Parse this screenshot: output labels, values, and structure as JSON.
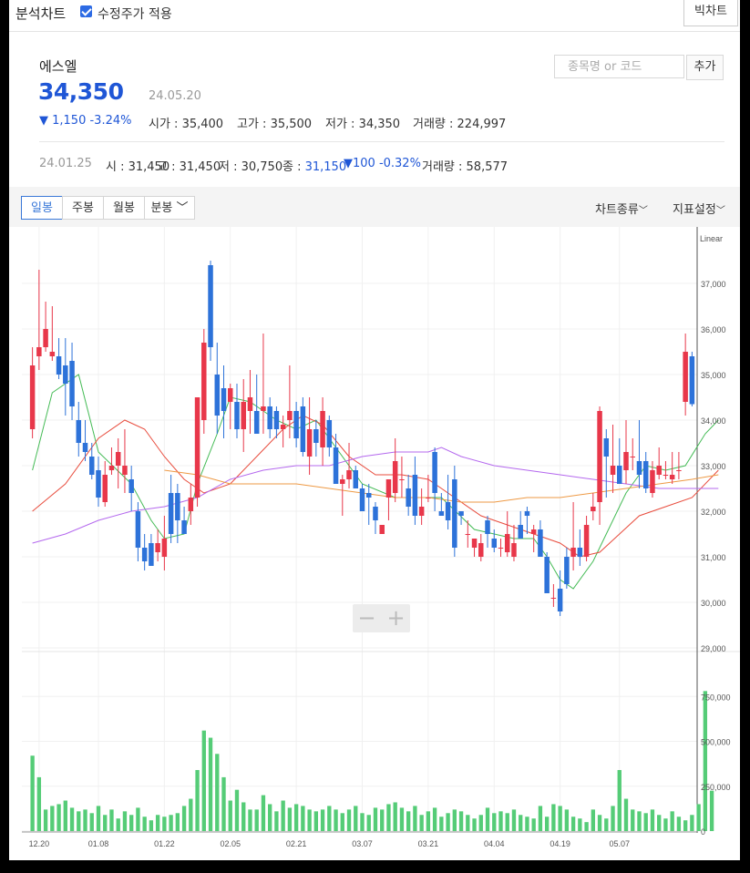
{
  "topbar": {
    "title": "분석차트",
    "adjusted_label": "수정주가 적용",
    "adjusted_checked": true,
    "big_chart_label": "빅차트"
  },
  "stock": {
    "name": "에스엘",
    "price": "34,350",
    "date": "24.05.20",
    "change": "▼ 1,150 -3.24%",
    "open": "시가 : 35,400",
    "high": "고가 : 35,500",
    "low": "저가 : 34,350",
    "volume": "거래량 : 224,997"
  },
  "search": {
    "placeholder": "종목명 or 코드",
    "add_label": "추가"
  },
  "history": {
    "date": "24.01.25",
    "open": "시 : 31,450",
    "high": "고 : 31,450",
    "low": "저 : 30,750",
    "close_label": "종 : ",
    "close": "31,150",
    "change": "▼100 -0.32%",
    "volume": "거래량 : 58,577"
  },
  "tabs": [
    "일봉",
    "주봉",
    "월봉",
    "분봉"
  ],
  "active_tab": "일봉",
  "menus": {
    "chart_type": "차트종류",
    "indicator": "지표설정"
  },
  "colors": {
    "up": "#e8374a",
    "down": "#2d72d9",
    "volume": "#55cc77",
    "ma5": "#44bb55",
    "ma20": "#e84c3d",
    "ma60": "#b468ee",
    "ma120": "#ee9944"
  },
  "chart_data": {
    "type": "candlestick",
    "scale_label": "Linear",
    "price_ticks": [
      "37,000",
      "36,000",
      "35,000",
      "34,000",
      "33,000",
      "32,000",
      "31,000",
      "30,000",
      "29,000"
    ],
    "volume_ticks": [
      "750,000",
      "500,000",
      "250,000",
      "0"
    ],
    "x_labels": [
      "12.20",
      "01.08",
      "01.22",
      "02.05",
      "02.21",
      "03.07",
      "03.21",
      "04.04",
      "04.19",
      "05.07"
    ],
    "x_label_index": [
      1,
      10,
      20,
      30,
      40,
      50,
      60,
      70,
      80,
      89
    ],
    "ylim": [
      29000,
      38000
    ],
    "candles": [
      [
        33800,
        35600,
        33600,
        35200
      ],
      [
        35400,
        37300,
        35100,
        35600
      ],
      [
        35600,
        36600,
        35500,
        36000
      ],
      [
        35400,
        36500,
        35300,
        35500
      ],
      [
        35400,
        35800,
        34900,
        35000
      ],
      [
        35200,
        35800,
        34100,
        34800
      ],
      [
        35300,
        35700,
        34000,
        34300
      ],
      [
        34000,
        34400,
        33200,
        33500
      ],
      [
        33500,
        34000,
        33100,
        33300
      ],
      [
        33200,
        33500,
        32700,
        32800
      ],
      [
        32900,
        33200,
        32100,
        32300
      ],
      [
        32200,
        33100,
        32100,
        32800
      ],
      [
        32900,
        33400,
        32800,
        33000
      ],
      [
        33000,
        33600,
        32500,
        33300
      ],
      [
        32800,
        33800,
        32400,
        33000
      ],
      [
        32700,
        33000,
        32000,
        32400
      ],
      [
        32000,
        32200,
        30900,
        31200
      ],
      [
        31200,
        31500,
        30700,
        30900
      ],
      [
        31300,
        31500,
        30800,
        30800
      ],
      [
        31100,
        31600,
        30900,
        31300
      ],
      [
        31000,
        31900,
        30700,
        31400
      ],
      [
        32400,
        32800,
        31300,
        31500
      ],
      [
        32400,
        32600,
        31300,
        31800
      ],
      [
        31800,
        32100,
        31500,
        31500
      ],
      [
        32000,
        32600,
        31700,
        32300
      ],
      [
        32300,
        34400,
        32100,
        34500
      ],
      [
        34000,
        36000,
        33700,
        35700
      ],
      [
        37400,
        37500,
        35300,
        35600
      ],
      [
        35000,
        35700,
        33700,
        34100
      ],
      [
        34700,
        35200,
        33600,
        34200
      ],
      [
        34400,
        34800,
        33800,
        34700
      ],
      [
        34400,
        34800,
        33600,
        33800
      ],
      [
        33800,
        34900,
        33300,
        34400
      ],
      [
        34200,
        35100,
        33700,
        34500
      ],
      [
        34200,
        35000,
        33700,
        33700
      ],
      [
        34200,
        35900,
        33700,
        34300
      ],
      [
        34300,
        34500,
        33600,
        33800
      ],
      [
        34200,
        34300,
        33600,
        33800
      ],
      [
        33800,
        34100,
        33400,
        33900
      ],
      [
        34000,
        35200,
        33600,
        34200
      ],
      [
        34200,
        34400,
        33400,
        33600
      ],
      [
        34300,
        34500,
        33200,
        33300
      ],
      [
        33200,
        34500,
        32800,
        33800
      ],
      [
        33800,
        34000,
        33200,
        33500
      ],
      [
        33400,
        34500,
        33000,
        34200
      ],
      [
        34000,
        34100,
        33200,
        33400
      ],
      [
        33400,
        33700,
        32600,
        32600
      ],
      [
        32600,
        32800,
        31900,
        32700
      ],
      [
        32700,
        33500,
        32500,
        32900
      ],
      [
        32900,
        33000,
        32500,
        32500
      ],
      [
        32500,
        32600,
        32000,
        32000
      ],
      [
        32400,
        32600,
        31700,
        32300
      ],
      [
        32100,
        32200,
        31500,
        31800
      ],
      [
        31500,
        31700,
        31500,
        31700
      ],
      [
        32300,
        32700,
        31800,
        32700
      ],
      [
        32400,
        33600,
        32200,
        33100
      ],
      [
        32700,
        33200,
        32300,
        32700
      ],
      [
        32500,
        32800,
        31900,
        32100
      ],
      [
        32800,
        33200,
        31700,
        31900
      ],
      [
        31900,
        32500,
        31700,
        32100
      ],
      [
        32300,
        32800,
        32200,
        32300
      ],
      [
        33300,
        33400,
        32000,
        32400
      ],
      [
        32000,
        32400,
        32000,
        31900
      ],
      [
        32200,
        32800,
        31600,
        31800
      ],
      [
        32700,
        33000,
        31000,
        31200
      ],
      [
        32000,
        32000,
        31700,
        31900
      ],
      [
        31500,
        31800,
        31200,
        31500
      ],
      [
        31200,
        31400,
        31000,
        31400
      ],
      [
        31000,
        31500,
        30900,
        31300
      ],
      [
        31800,
        31900,
        31200,
        31500
      ],
      [
        31400,
        31600,
        31100,
        31200
      ],
      [
        31200,
        31400,
        31000,
        31200
      ],
      [
        31100,
        32000,
        31000,
        31500
      ],
      [
        31000,
        31700,
        30900,
        31300
      ],
      [
        31700,
        32000,
        31600,
        31400
      ],
      [
        32000,
        32100,
        31500,
        31900
      ],
      [
        31500,
        31700,
        31100,
        31600
      ],
      [
        31600,
        31800,
        31000,
        31000
      ],
      [
        31000,
        31100,
        30400,
        30200
      ],
      [
        30100,
        30400,
        29900,
        30100
      ],
      [
        30300,
        30700,
        29700,
        29800
      ],
      [
        31000,
        31200,
        30300,
        30400
      ],
      [
        31000,
        32200,
        30700,
        31200
      ],
      [
        31200,
        31600,
        30800,
        31000
      ],
      [
        31000,
        31900,
        30900,
        31700
      ],
      [
        32000,
        32400,
        31800,
        32100
      ],
      [
        32200,
        34300,
        31700,
        34200
      ],
      [
        33600,
        33800,
        32300,
        33200
      ],
      [
        32800,
        33900,
        32400,
        33000
      ],
      [
        33000,
        33600,
        32600,
        32600
      ],
      [
        32900,
        34000,
        32600,
        33300
      ],
      [
        33200,
        33600,
        32900,
        33200
      ],
      [
        33100,
        34000,
        32500,
        32800
      ],
      [
        33100,
        33300,
        32400,
        32500
      ],
      [
        32400,
        33100,
        32300,
        32900
      ],
      [
        32800,
        33400,
        32700,
        33000
      ],
      [
        32800,
        33100,
        32700,
        32800
      ],
      [
        32700,
        33300,
        32600,
        32800
      ],
      [
        32900,
        33300,
        32700,
        32900
      ],
      [
        34400,
        35900,
        34100,
        35500
      ],
      [
        35400,
        35500,
        34300,
        34350
      ]
    ],
    "volumes": [
      420000,
      300000,
      120000,
      140000,
      150000,
      170000,
      130000,
      110000,
      120000,
      100000,
      140000,
      90000,
      120000,
      70000,
      110000,
      90000,
      130000,
      80000,
      60000,
      90000,
      80000,
      90000,
      100000,
      140000,
      180000,
      340000,
      560000,
      520000,
      430000,
      300000,
      170000,
      230000,
      160000,
      120000,
      120000,
      200000,
      150000,
      110000,
      170000,
      130000,
      150000,
      140000,
      120000,
      110000,
      120000,
      140000,
      120000,
      100000,
      120000,
      140000,
      100000,
      90000,
      130000,
      120000,
      150000,
      160000,
      130000,
      110000,
      140000,
      90000,
      110000,
      130000,
      80000,
      100000,
      120000,
      110000,
      90000,
      70000,
      90000,
      130000,
      100000,
      110000,
      100000,
      120000,
      90000,
      80000,
      70000,
      140000,
      80000,
      150000,
      140000,
      120000,
      80000,
      70000,
      50000,
      120000,
      90000,
      70000,
      140000,
      340000,
      180000,
      120000,
      110000,
      100000,
      120000,
      90000,
      70000,
      110000,
      80000,
      60000,
      90000,
      150000,
      780000,
      224997
    ],
    "ma_series": [
      {
        "name": "MA5",
        "points": [
          [
            0,
            32900
          ],
          [
            3,
            34600
          ],
          [
            7,
            35000
          ],
          [
            10,
            33300
          ],
          [
            15,
            32600
          ],
          [
            18,
            31800
          ],
          [
            20,
            31400
          ],
          [
            23,
            31500
          ],
          [
            25,
            32600
          ],
          [
            28,
            33700
          ],
          [
            30,
            34500
          ],
          [
            33,
            34400
          ],
          [
            37,
            34000
          ],
          [
            40,
            33800
          ],
          [
            43,
            34000
          ],
          [
            46,
            33400
          ],
          [
            50,
            32600
          ],
          [
            55,
            32300
          ],
          [
            58,
            32300
          ],
          [
            62,
            32300
          ],
          [
            67,
            31600
          ],
          [
            70,
            31500
          ],
          [
            73,
            31400
          ],
          [
            76,
            31400
          ],
          [
            78,
            31000
          ],
          [
            80,
            30500
          ],
          [
            82,
            30300
          ],
          [
            85,
            30900
          ],
          [
            87,
            31500
          ],
          [
            90,
            32400
          ],
          [
            93,
            33000
          ],
          [
            96,
            32900
          ],
          [
            99,
            33000
          ],
          [
            102,
            33700
          ],
          [
            104,
            34000
          ]
        ]
      },
      {
        "name": "MA20",
        "points": [
          [
            0,
            32000
          ],
          [
            5,
            32600
          ],
          [
            10,
            33600
          ],
          [
            14,
            34000
          ],
          [
            17,
            33800
          ],
          [
            20,
            33200
          ],
          [
            23,
            32700
          ],
          [
            26,
            32400
          ],
          [
            30,
            32600
          ],
          [
            34,
            33200
          ],
          [
            38,
            33800
          ],
          [
            41,
            34100
          ],
          [
            44,
            33900
          ],
          [
            48,
            33200
          ],
          [
            52,
            32800
          ],
          [
            56,
            32800
          ],
          [
            60,
            32700
          ],
          [
            64,
            32300
          ],
          [
            68,
            31900
          ],
          [
            72,
            31700
          ],
          [
            76,
            31500
          ],
          [
            80,
            31300
          ],
          [
            83,
            31000
          ],
          [
            86,
            31100
          ],
          [
            89,
            31500
          ],
          [
            92,
            31900
          ],
          [
            96,
            32100
          ],
          [
            100,
            32300
          ],
          [
            104,
            32900
          ]
        ]
      },
      {
        "name": "MA60",
        "points": [
          [
            0,
            31300
          ],
          [
            5,
            31500
          ],
          [
            10,
            31800
          ],
          [
            15,
            32000
          ],
          [
            20,
            32100
          ],
          [
            25,
            32300
          ],
          [
            30,
            32700
          ],
          [
            35,
            32900
          ],
          [
            40,
            33000
          ],
          [
            45,
            33000
          ],
          [
            50,
            33200
          ],
          [
            55,
            33300
          ],
          [
            60,
            33300
          ],
          [
            62,
            33400
          ],
          [
            65,
            33200
          ],
          [
            70,
            33000
          ],
          [
            75,
            32900
          ],
          [
            80,
            32800
          ],
          [
            85,
            32700
          ],
          [
            90,
            32600
          ],
          [
            95,
            32500
          ],
          [
            100,
            32500
          ],
          [
            104,
            32500
          ]
        ]
      },
      {
        "name": "MA120",
        "points": [
          [
            20,
            32900
          ],
          [
            25,
            32800
          ],
          [
            30,
            32600
          ],
          [
            35,
            32600
          ],
          [
            40,
            32600
          ],
          [
            45,
            32500
          ],
          [
            50,
            32400
          ],
          [
            55,
            32300
          ],
          [
            60,
            32300
          ],
          [
            65,
            32200
          ],
          [
            70,
            32200
          ],
          [
            75,
            32300
          ],
          [
            80,
            32300
          ],
          [
            85,
            32400
          ],
          [
            90,
            32500
          ],
          [
            95,
            32600
          ],
          [
            100,
            32700
          ],
          [
            104,
            32800
          ]
        ]
      }
    ]
  }
}
